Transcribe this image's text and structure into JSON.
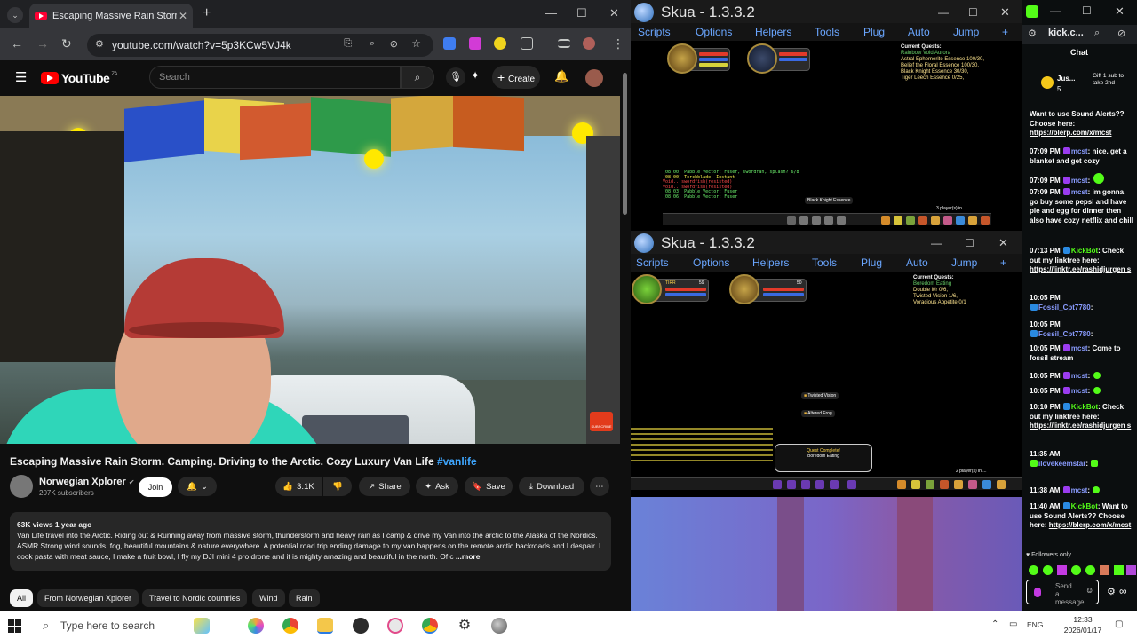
{
  "chrome": {
    "tab_title": "Escaping Massive Rain Storm",
    "new_tab": "+",
    "url": "youtube.com/watch?v=5p3KCw5VJ4k"
  },
  "youtube": {
    "logo_text": "YouTube",
    "country_code": "ZA",
    "search_placeholder": "Search",
    "create_label": "Create",
    "video_title": "Escaping Massive Rain Storm. Camping. Driving to the Arctic. Cozy Luxury Van Life ",
    "video_hashtag": "#vanlife",
    "channel_name": "Norwegian Xplorer",
    "channel_subs": "207K subscribers",
    "join_label": "Join",
    "like_count": "3.1K",
    "share_label": "Share",
    "ask_label": "Ask",
    "save_label": "Save",
    "download_label": "Download",
    "desc_meta": "63K views  1 year ago",
    "desc_text": "Van Life travel into the Arctic. Riding out & Running away from massive storm, thunderstorm and heavy rain as I camp & drive my Van into the arctic to the Alaska of the Nordics. ASMR Strong wind sounds, fog, beautiful mountains & nature everywhere. A potential road trip ending damage to my van happens on the remote arctic backroads and I despair. I cook pasta with meat sauce, I make a fruit bowl, I fly my DJI mini 4 pro drone and it is mighty amazing and beautiful in the north. Of c",
    "desc_more": " ...more",
    "chips": [
      "All",
      "From Norwegian Xplorer",
      "Travel to Nordic countries",
      "Wind",
      "Rain"
    ],
    "subscribe_overlay": "SUBSCRIBE"
  },
  "skua_top": {
    "title": "Skua - 1.3.3.2",
    "menu": [
      "Scripts",
      "Options",
      "Helpers",
      "Tools",
      "Plug",
      "Auto",
      "Jump",
      "+"
    ],
    "quest_header": "Current Quests:",
    "quests": [
      "Rainbow Void Aurora",
      "Astral Ephemerite Essence 100/30,",
      "Belief the Floral Essence 100/30,",
      "Black Knight Essence 30/30,",
      "Tiger Leech Essence 0/25,"
    ],
    "chat": [
      "[08:00] Pabble Vector: Fuser, swordfan, splash? 6/8",
      "[08:00] Torchblade: Instant",
      "Void...swordfish(resisted)",
      "Void...swordfish(resisted)",
      "[08:03] Pabble Vector: Fuser",
      "[08:06] Pabble Vector: Fuser"
    ],
    "center_label": "Black Knight Essence",
    "players_online": "3 player(s) in ..."
  },
  "skua_bottom": {
    "title": "Skua - 1.3.3.2",
    "menu": [
      "Scripts",
      "Options",
      "Helpers",
      "Tools",
      "Plug",
      "Auto",
      "Jump",
      "+"
    ],
    "quest_header": "Current Quests:",
    "quests": [
      "Boredom Eating",
      "Double it/r 0/6,",
      "Twisted Vision 1/6,",
      "Voracious Appetite 0/1"
    ],
    "hud1_name": "TIRR",
    "hud1_level": "59",
    "hud2_level": "50",
    "loot1": "Twisted Vision",
    "loot2": "Altered Frog",
    "quest_complete": "Quest Complete!",
    "quest_complete_name": "Boredom Eating",
    "players_online": "2 player(s) in ..."
  },
  "kick": {
    "url": "kick.c...",
    "chat_header": "Chat",
    "gift_user": "Jus...",
    "gift_count": "5",
    "gift_text": "Gift 1 sub to take 2nd",
    "messages": [
      {
        "time": "",
        "user": "",
        "text": "Want to use Sound Alerts?? Choose here:",
        "link": "https://blerp.com/x/mcst"
      },
      {
        "time": "07:09 PM",
        "user": "mcst",
        "text": ": nice. get a blanket and get cozy",
        "link": ""
      },
      {
        "time": "07:09 PM",
        "user": "mcst",
        "text": ":",
        "link": ""
      },
      {
        "time": "07:09 PM",
        "user": "mcst",
        "text": ": im gonna go buy some pepsi and have pie and egg for dinner then also have cozy netflix and chill",
        "link": ""
      },
      {
        "time": "07:13 PM",
        "user": "KickBot",
        "text": ": Check out my linktree here:",
        "link": "https://linktr.ee/rashidjurgen s"
      },
      {
        "time": "10:05 PM",
        "user": "Fossil_Cpt7780",
        "text": ":",
        "link": ""
      },
      {
        "time": "10:05 PM",
        "user": "Fossil_Cpt7780",
        "text": ":",
        "link": ""
      },
      {
        "time": "10:05 PM",
        "user": "mcst",
        "text": ": Come to fossil stream",
        "link": ""
      },
      {
        "time": "10:05 PM",
        "user": "mcst",
        "text": ":",
        "link": ""
      },
      {
        "time": "10:05 PM",
        "user": "mcst",
        "text": ":",
        "link": ""
      },
      {
        "time": "10:10 PM",
        "user": "KickBot",
        "text": ": Check out my linktree here:",
        "link": "https://linktr.ee/rashidjurgen s"
      },
      {
        "time": "11:35 AM",
        "user": "ilovekeemstar",
        "text": ":",
        "link": ""
      },
      {
        "time": "11:38 AM",
        "user": "mcst",
        "text": ":",
        "link": ""
      },
      {
        "time": "11:40 AM",
        "user": "KickBot",
        "text": ": Want to use Sound Alerts?? Choose here:",
        "link": "https://blerp.com/x/mcst"
      }
    ],
    "followers_only": "Followers only",
    "input_placeholder": "Send a message"
  },
  "taskbar": {
    "search_placeholder": "Type here to search",
    "language": "ENG",
    "time": "12:33",
    "date": "2026/01/17"
  },
  "colors": {
    "kick_green": "#53fc18",
    "yt_red": "#ff0000",
    "link_blue": "#3ea6ff",
    "skua_menu": "#6aa6ff"
  }
}
